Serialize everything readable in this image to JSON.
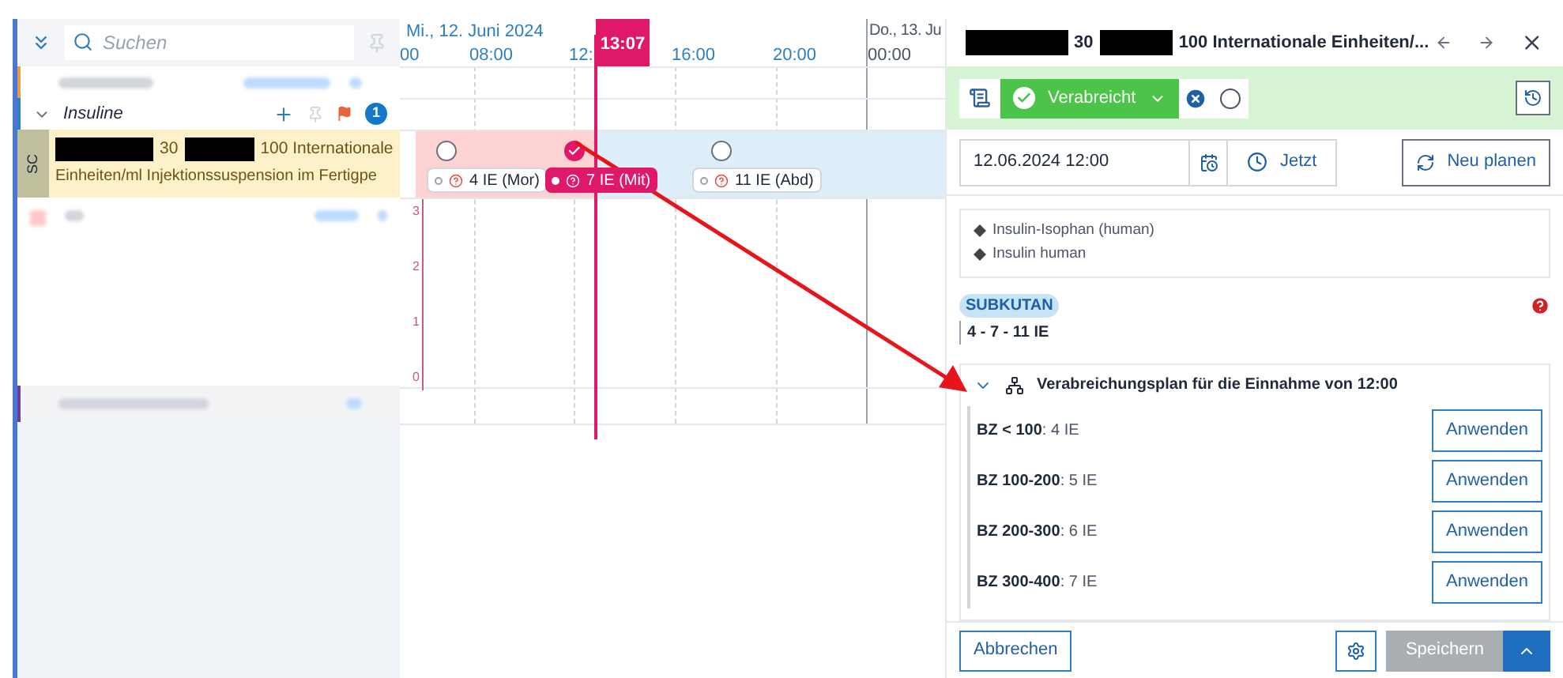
{
  "search": {
    "placeholder": "Suchen"
  },
  "group": {
    "title": "Insuline",
    "badge": "1",
    "expanded": true
  },
  "medication": {
    "route_tag": "SC",
    "dose_a": "30",
    "dose_b": "100  Internationale",
    "line_2": "Einheiten/ml Injektionssuspension im Fertigpe"
  },
  "timeline": {
    "date_1": "Mi., 12. Juni 2024",
    "date_2": "Do., 13. Ju",
    "hours": [
      "00",
      "08:00",
      "12:",
      "16:00",
      "20:00",
      "00:00"
    ],
    "now": "13:07",
    "doses": [
      {
        "label": "4 IE (Mor)",
        "checked": false
      },
      {
        "label": "7 IE (Mit)",
        "checked": true
      },
      {
        "label": "11 IE (Abd)",
        "checked": false
      }
    ],
    "y_ticks": [
      "3",
      "2",
      "1",
      "0"
    ]
  },
  "detail": {
    "title_a": "30",
    "title_b": "100 Internationale Einheiten/...",
    "status": "Verabreicht",
    "date": "12.06.2024 12:00",
    "now_button": "Jetzt",
    "replan_button": "Neu planen",
    "ingredients": [
      "Insulin-Isophan (human)",
      "Insulin human"
    ],
    "route": "SUBKUTAN",
    "dose": "4 - 7 - 11 IE",
    "plan": {
      "title": "Verabreichungsplan für die Einnahme von 12:00",
      "expanded": true,
      "rules": [
        {
          "text": "**BZ < 100**: 4 IE",
          "button": "Anwenden"
        },
        {
          "text": "**BZ 100-200**: 5 IE",
          "button": "Anwenden"
        },
        {
          "text": "**BZ 200-300**: 6 IE",
          "button": "Anwenden"
        },
        {
          "text": "**BZ 300-400**: 7 IE",
          "button": "Anwenden"
        }
      ]
    },
    "cancel": "Abbrechen",
    "save": "Speichern",
    "save_disabled": true
  }
}
